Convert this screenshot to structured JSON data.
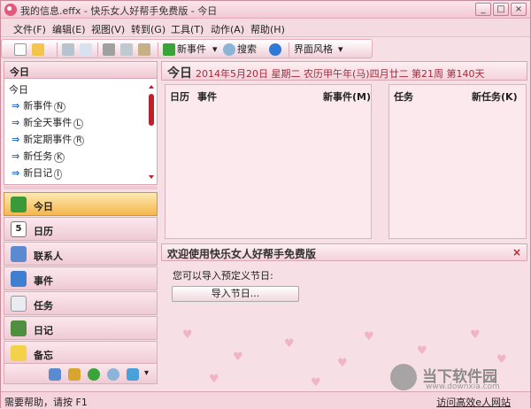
{
  "window": {
    "title": "我的信息.effx - 快乐女人好帮手免费版 - 今日",
    "controls": [
      "_",
      "□",
      "×"
    ]
  },
  "menubar": [
    "文件(F)",
    "编辑(E)",
    "视图(V)",
    "转到(G)",
    "工具(T)",
    "动作(A)",
    "帮助(H)"
  ],
  "toolbar": {
    "new_event": "新事件",
    "search": "搜索",
    "skin": "界面风格"
  },
  "left": {
    "header": "今日",
    "sub": "今日",
    "items": [
      {
        "label": "新事件",
        "key": "N"
      },
      {
        "label": "新全天事件",
        "key": "L"
      },
      {
        "label": "新定期事件",
        "key": "R"
      },
      {
        "label": "新任务",
        "key": "K"
      },
      {
        "label": "新日记",
        "key": "I"
      }
    ]
  },
  "nav": [
    "今日",
    "日历",
    "联系人",
    "事件",
    "任务",
    "日记",
    "备忘"
  ],
  "today": {
    "label": "今日",
    "info": "2014年5月20日  星期二  农历甲午年(马)四月廿二   第21周  第140天"
  },
  "calendar": {
    "col1": "日历",
    "col2": "事件",
    "new": "新事件",
    "newkey": "M"
  },
  "tasks": {
    "col1": "任务",
    "new": "新任务",
    "newkey": "K"
  },
  "welcome": {
    "title": "欢迎使用快乐女人好帮手免费版",
    "close": "×",
    "prompt": "您可以导入预定义节日:",
    "button": "导入节日..."
  },
  "status": {
    "left": "需要帮助，请按 F1",
    "right": "访问高效e人网站"
  },
  "watermark": {
    "name": "当下软件园",
    "url": "www.downxia.com"
  },
  "colors": {
    "accent": "#f5b64c",
    "panel": "#fbe9ee",
    "link": "#1f63c9"
  }
}
